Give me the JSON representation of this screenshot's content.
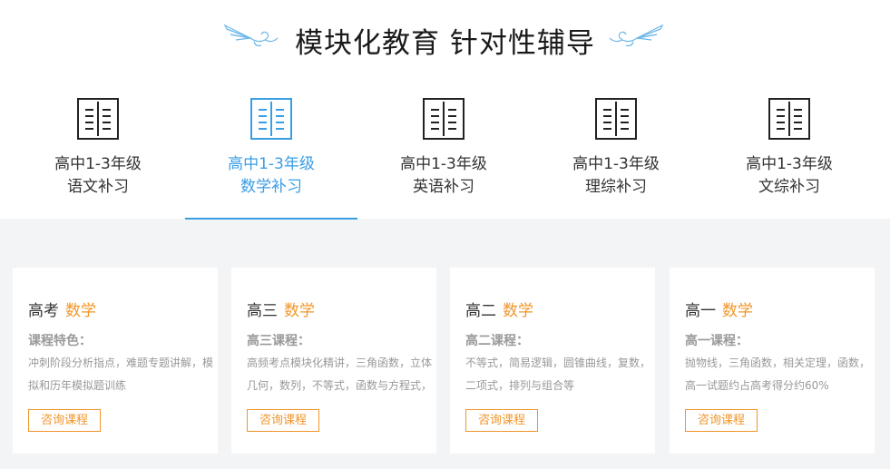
{
  "header": {
    "title": "模块化教育 针对性辅导"
  },
  "tabs": [
    {
      "line1": "高中1-3年级",
      "line2": "语文补习",
      "active": false
    },
    {
      "line1": "高中1-3年级",
      "line2": "数学补习",
      "active": true
    },
    {
      "line1": "高中1-3年级",
      "line2": "英语补习",
      "active": false
    },
    {
      "line1": "高中1-3年级",
      "line2": "理综补习",
      "active": false
    },
    {
      "line1": "高中1-3年级",
      "line2": "文综补习",
      "active": false
    }
  ],
  "cards": [
    {
      "grade": "高考",
      "subject": "数学",
      "label": "课程特色：",
      "desc": "冲刺阶段分析指点，难题专题讲解，模拟和历年模拟题训练",
      "button": "咨询课程"
    },
    {
      "grade": "高三",
      "subject": "数学",
      "label": "高三课程：",
      "desc": "高频考点模块化精讲，三角函数，立体几何，数列，不等式，函数与方程式，",
      "button": "咨询课程"
    },
    {
      "grade": "高二",
      "subject": "数学",
      "label": "高二课程：",
      "desc": "不等式，简易逻辑，圆锥曲线，复数，二项式，排列与组合等",
      "button": "咨询课程"
    },
    {
      "grade": "高一",
      "subject": "数学",
      "label": "高一课程：",
      "desc": "抛物线，三角函数，相关定理，函数，高一试题约占高考得分约60%",
      "button": "咨询课程"
    }
  ],
  "colors": {
    "accent_blue": "#3a9ee4",
    "accent_orange": "#f0962a",
    "text_dark": "#333333",
    "text_gray": "#999999",
    "content_bg": "#f3f4f6"
  },
  "icons": {
    "header_decoration": "paper-plane-wing-icon",
    "tab_icon": "book-icon"
  }
}
